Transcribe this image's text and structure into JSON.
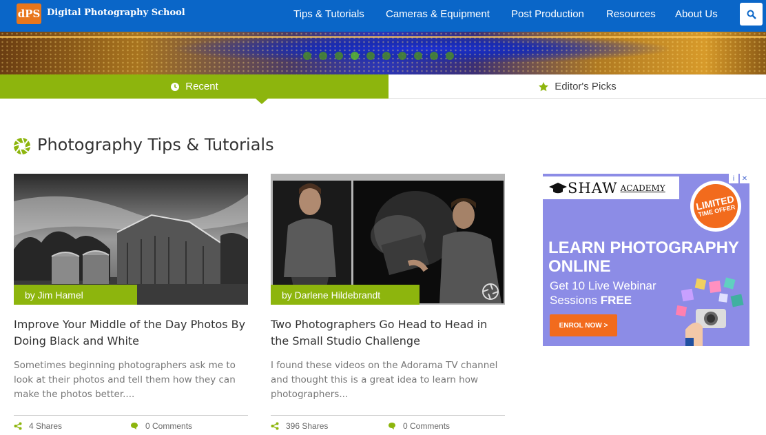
{
  "header": {
    "logo_mark": "dPS",
    "site_name": "Digital Photography School",
    "nav": [
      "Tips & Tutorials",
      "Cameras & Equipment",
      "Post Production",
      "Resources",
      "About Us"
    ]
  },
  "tabs": [
    {
      "label": "Recent",
      "active": true
    },
    {
      "label": "Editor's Picks",
      "active": false
    }
  ],
  "section": {
    "title": "Photography Tips & Tutorials"
  },
  "articles": [
    {
      "byline": "by Jim Hamel",
      "title": "Improve Your Middle of the Day Photos By Doing Black and White",
      "excerpt": "Sometimes beginning photographers ask me to look at their photos and tell them how they can make the photos better....",
      "shares": "4 Shares",
      "comments": "0 Comments"
    },
    {
      "byline": "by Darlene Hildebrandt",
      "title": "Two Photographers Go Head to Head in the Small Studio Challenge",
      "excerpt": "I found these videos on the Adorama TV channel and thought this is a great idea to learn how photographers...",
      "shares": "396 Shares",
      "comments": "0 Comments"
    }
  ],
  "ad": {
    "brand": "SHAW",
    "brand_sub": "ACADEMY",
    "badge_line1": "LIMITED",
    "badge_line2": "TIME OFFER",
    "headline": "LEARN PHOTOGRAPHY ONLINE",
    "sub_line1": "Get 10 Live Webinar",
    "sub_line2": "Sessions ",
    "sub_bold": "FREE",
    "cta": "ENROL NOW >"
  },
  "colors": {
    "brand_blue": "#0a66c8",
    "accent_green": "#8db50d",
    "logo_orange": "#e8761c",
    "ad_purple": "#8c8ce6",
    "ad_orange": "#f26b1d"
  },
  "icons": [
    "search-icon",
    "clock-icon",
    "star-icon",
    "aperture-icon",
    "share-icon",
    "comment-icon",
    "info-icon",
    "close-icon"
  ]
}
